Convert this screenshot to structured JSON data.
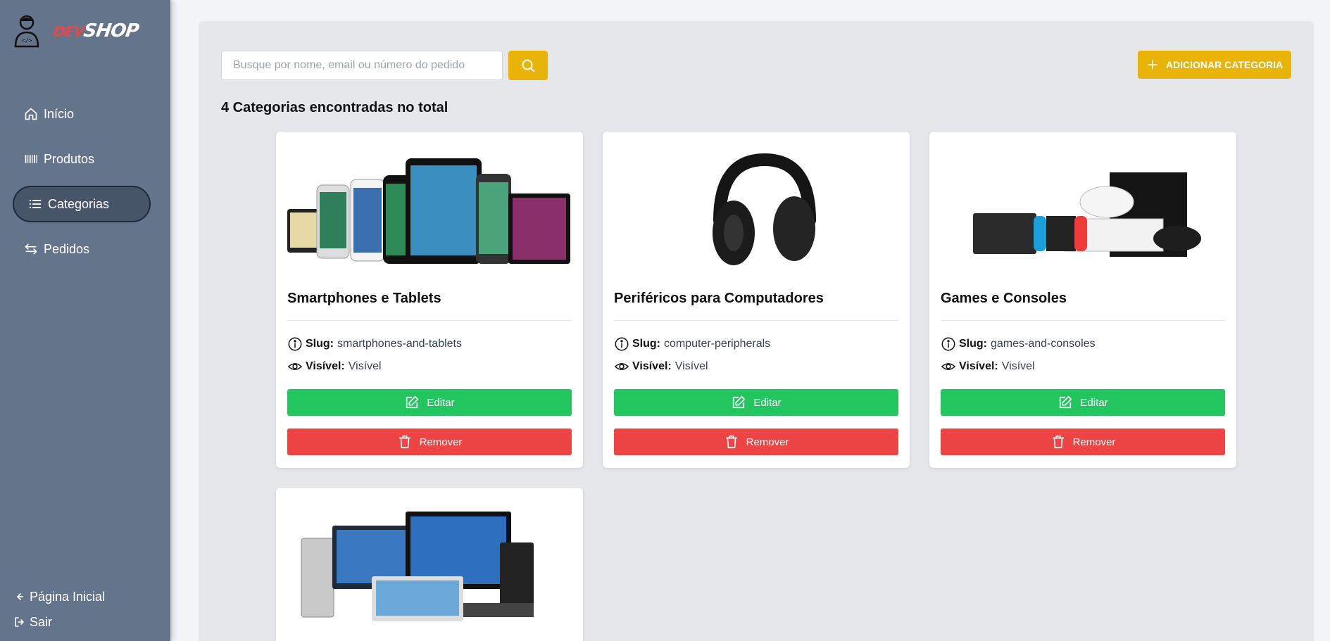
{
  "brand": {
    "name_part1": "DEV",
    "name_part2": "SHOP"
  },
  "sidebar": {
    "nav": [
      {
        "label": "Início",
        "icon": "home-icon"
      },
      {
        "label": "Produtos",
        "icon": "barcode-icon"
      },
      {
        "label": "Categorias",
        "icon": "list-icon",
        "active": true
      },
      {
        "label": "Pedidos",
        "icon": "arrows-swap-icon"
      }
    ],
    "bottom": [
      {
        "label": "Página Inicial",
        "icon": "arrow-left-icon"
      },
      {
        "label": "Sair",
        "icon": "logout-icon"
      }
    ]
  },
  "toolbar": {
    "search_placeholder": "Busque por nome, email ou número do pedido",
    "search_value": "",
    "add_label": "ADICIONAR CATEGORIA"
  },
  "result_count": "4 Categorias encontradas no total",
  "labels": {
    "slug": "Slug:",
    "visible": "Visível:",
    "edit": "Editar",
    "remove": "Remover"
  },
  "categories": [
    {
      "title": "Smartphones e Tablets",
      "slug": "smartphones-and-tablets",
      "visibility": "Visível",
      "image": "phones-tablets-image"
    },
    {
      "title": "Periféricos para Computadores",
      "slug": "computer-peripherals",
      "visibility": "Visível",
      "image": "headphones-image"
    },
    {
      "title": "Games e Consoles",
      "slug": "games-and-consoles",
      "visibility": "Visível",
      "image": "consoles-image"
    },
    {
      "title": "",
      "slug": "",
      "visibility": "",
      "image": "computers-image"
    }
  ],
  "colors": {
    "sidebar": "#64748b",
    "accent": "#eab308",
    "edit": "#22c55e",
    "remove": "#ef4444"
  }
}
